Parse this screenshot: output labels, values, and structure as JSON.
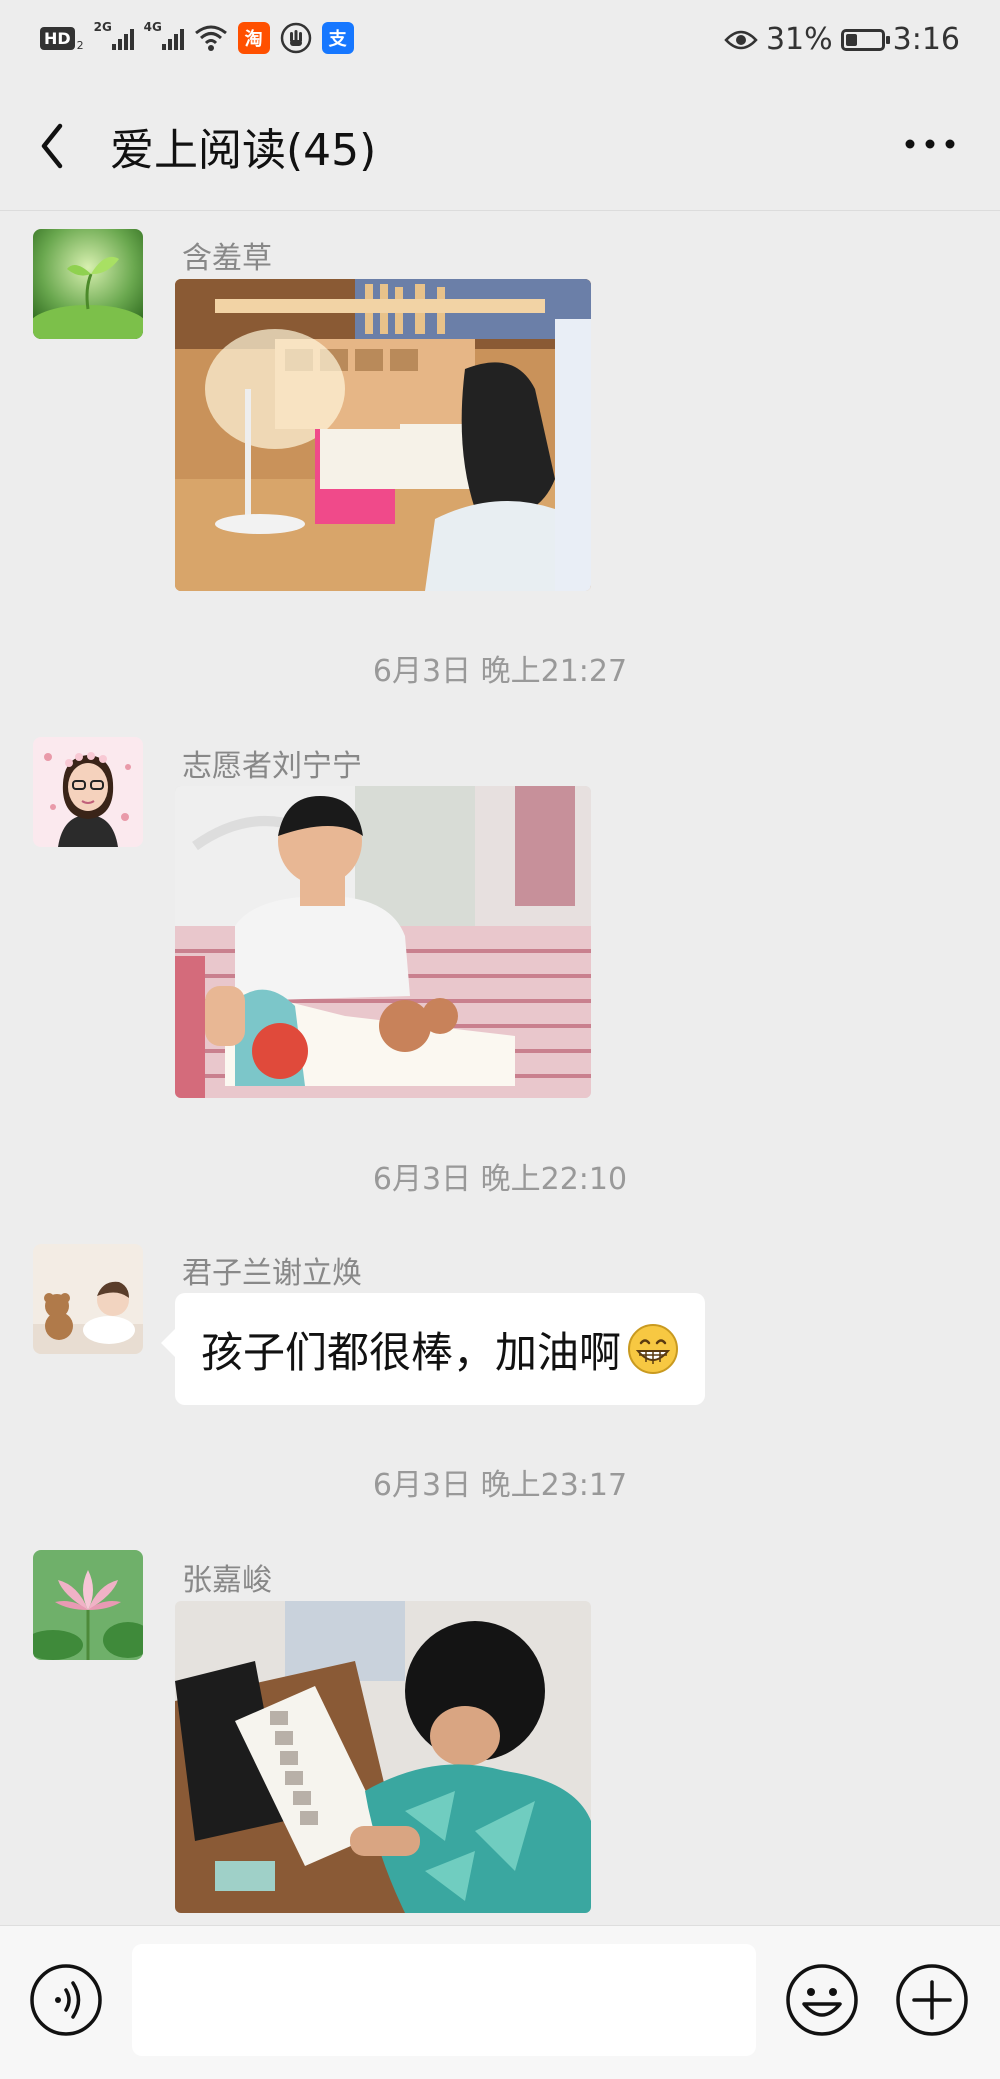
{
  "status_bar": {
    "hd_label": "HD",
    "hd_sub": "2",
    "net1": "2G",
    "net2": "4G",
    "taobao_glyph": "淘",
    "alipay_glyph": "支",
    "battery_percent": "31%",
    "battery_level": 0.31,
    "time": "3:16",
    "icons": [
      "eye-icon",
      "wifi-icon",
      "hand-icon",
      "battery-icon"
    ]
  },
  "nav": {
    "title": "爱上阅读(45)"
  },
  "messages": [
    {
      "sender": "含羞草",
      "type": "image",
      "avatar": "sprout-avatar",
      "photo": "girl-reading-at-desk"
    },
    {
      "timestamp": "6月3日 晚上21:27"
    },
    {
      "sender": "志愿者刘宁宁",
      "type": "image",
      "avatar": "woman-portrait-avatar",
      "photo": "boy-reading-on-bed"
    },
    {
      "timestamp": "6月3日 晚上22:10"
    },
    {
      "sender": "君子兰谢立焕",
      "type": "text",
      "text": "孩子们都很棒，加油啊",
      "avatar": "baby-teddy-avatar",
      "emoji": "grinning-emoji"
    },
    {
      "timestamp": "6月3日 晚上23:17"
    },
    {
      "sender": "张嘉峻",
      "type": "image",
      "avatar": "lotus-avatar",
      "photo": "boy-reading-comic"
    }
  ],
  "input_bar": {
    "text_value": "",
    "icons": [
      "voice-icon",
      "emoji-icon",
      "plus-icon"
    ]
  },
  "colors": {
    "background": "#ededed",
    "bubble": "#ffffff",
    "meta_text": "#999999",
    "sender_text": "#888888"
  }
}
